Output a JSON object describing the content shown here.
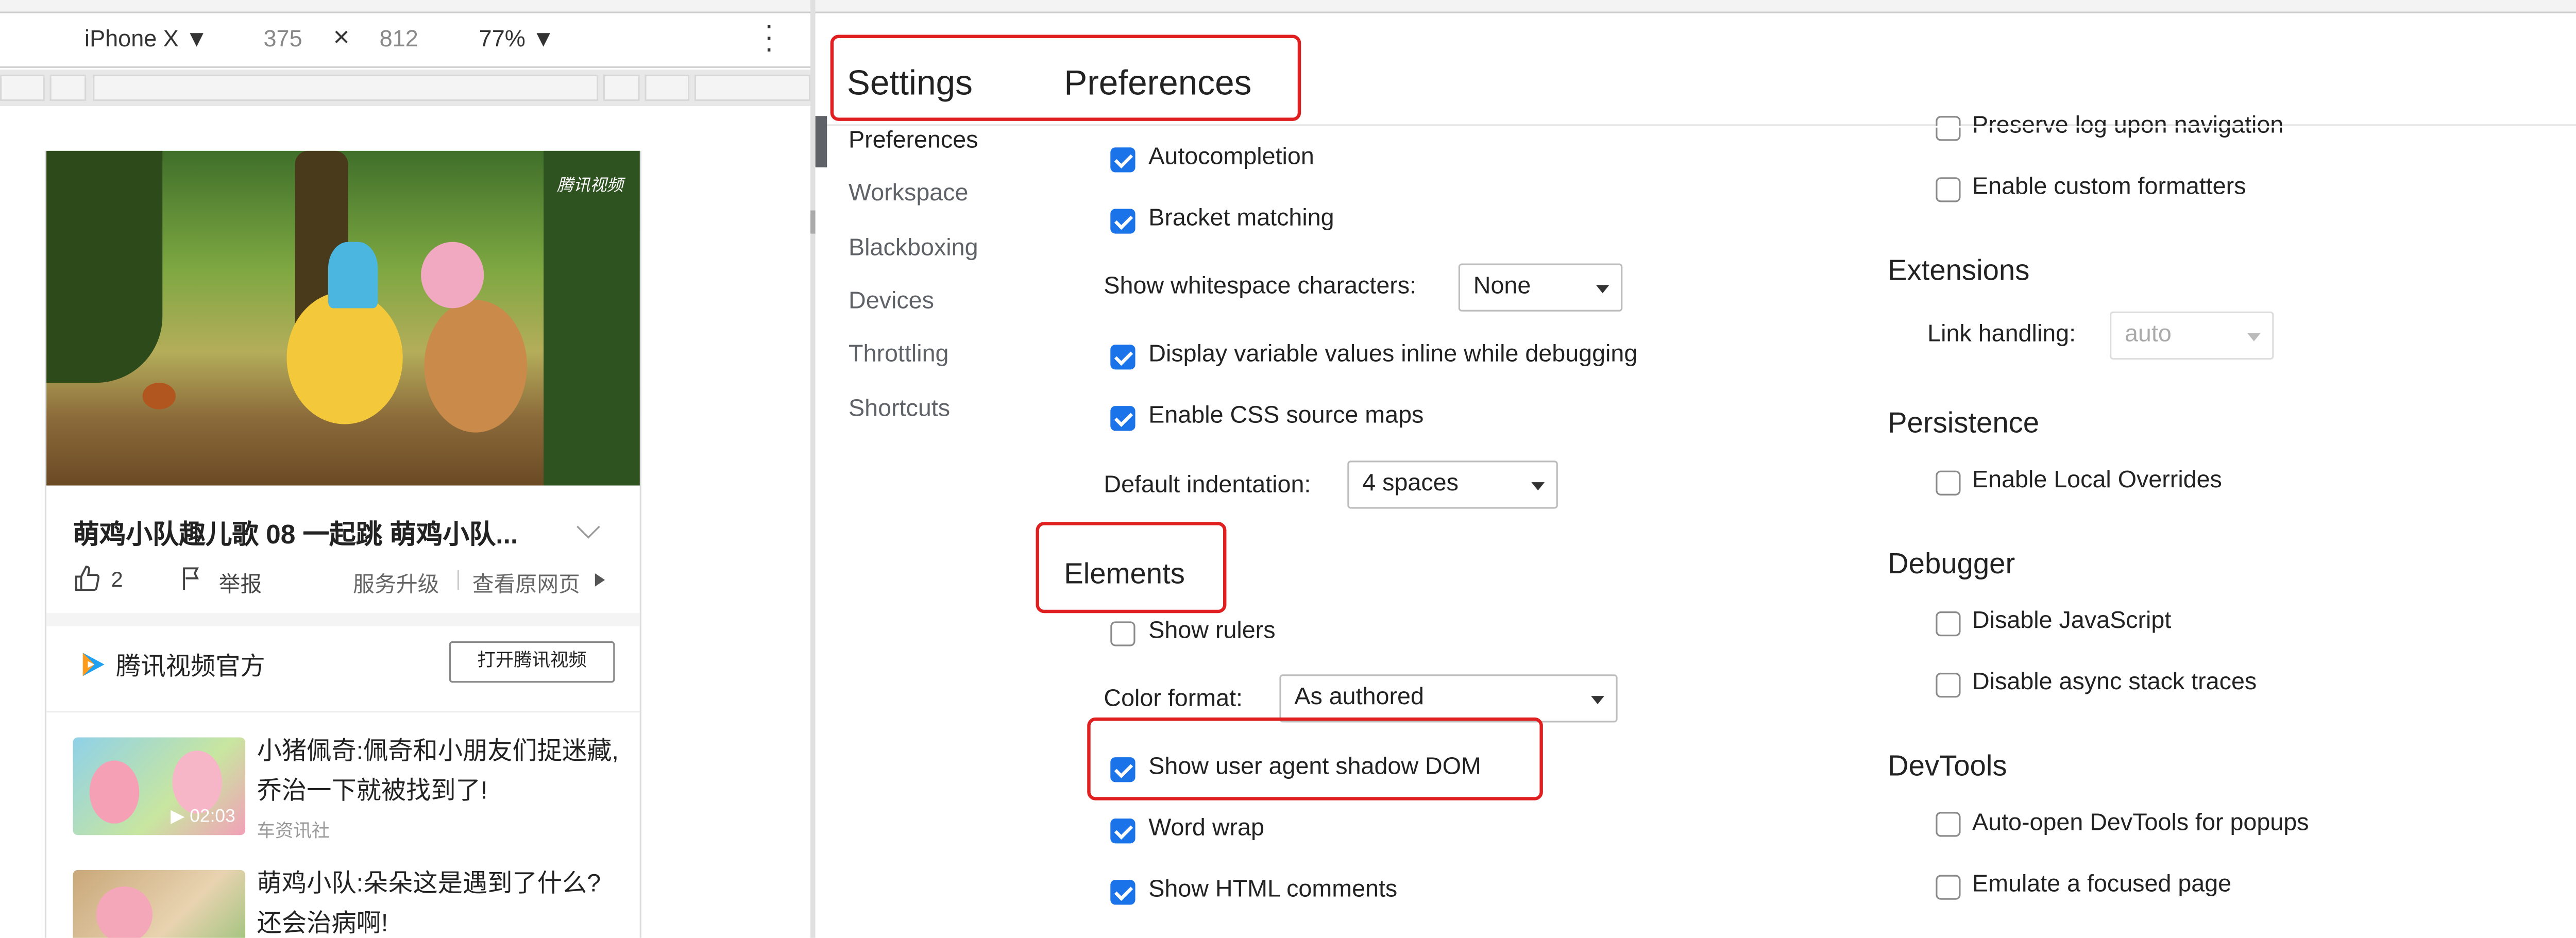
{
  "device_toolbar": {
    "device": "iPhone X ▼",
    "width": "375",
    "times": "×",
    "height": "812",
    "zoom": "77% ▼"
  },
  "phone": {
    "video_watermark": "腾讯视频",
    "video_title": "萌鸡小队趣儿歌 08 一起跳 萌鸡小队...",
    "likes": "2",
    "report": "举报",
    "service_upgrade": "服务升级",
    "view_original": "查看原网页",
    "publisher": "腾讯视频官方",
    "open_app": "打开腾讯视频",
    "related": [
      {
        "title": "小猪佩奇:佩奇和小朋友们捉迷藏,乔治一下就被找到了!",
        "source": "车资讯社",
        "duration": "▶ 02:03"
      },
      {
        "title": "萌鸡小队:朵朵这是遇到了什么?还会治病啊!",
        "source": "",
        "duration": ""
      }
    ]
  },
  "settings": {
    "title": "Settings",
    "page_title": "Preferences",
    "nav": [
      "Preferences",
      "Workspace",
      "Blackboxing",
      "Devices",
      "Throttling",
      "Shortcuts"
    ],
    "sources_options": {
      "autocompletion": "Autocompletion",
      "bracket_matching": "Bracket matching",
      "whitespace_label": "Show whitespace characters:",
      "whitespace_value": "None",
      "inline_values": "Display variable values inline while debugging",
      "css_source_maps": "Enable CSS source maps",
      "indentation_label": "Default indentation:",
      "indentation_value": "4 spaces"
    },
    "elements": {
      "heading": "Elements",
      "show_rulers": "Show rulers",
      "color_format_label": "Color format:",
      "color_format_value": "As authored",
      "shadow_dom": "Show user agent shadow DOM",
      "word_wrap": "Word wrap",
      "html_comments": "Show HTML comments"
    },
    "console": {
      "preserve_log": "Preserve log upon navigation",
      "custom_formatters": "Enable custom formatters"
    },
    "extensions": {
      "heading": "Extensions",
      "link_label": "Link handling:",
      "link_value": "auto"
    },
    "persistence": {
      "heading": "Persistence",
      "local_overrides": "Enable Local Overrides"
    },
    "debugger": {
      "heading": "Debugger",
      "disable_js": "Disable JavaScript",
      "disable_async": "Disable async stack traces"
    },
    "devtools": {
      "heading": "DevTools",
      "auto_open": "Auto-open DevTools for popups",
      "focused_page": "Emulate a focused page"
    }
  },
  "colors": {
    "checkbox_on": "#1a73e8",
    "highlight_box": "#e02020"
  }
}
